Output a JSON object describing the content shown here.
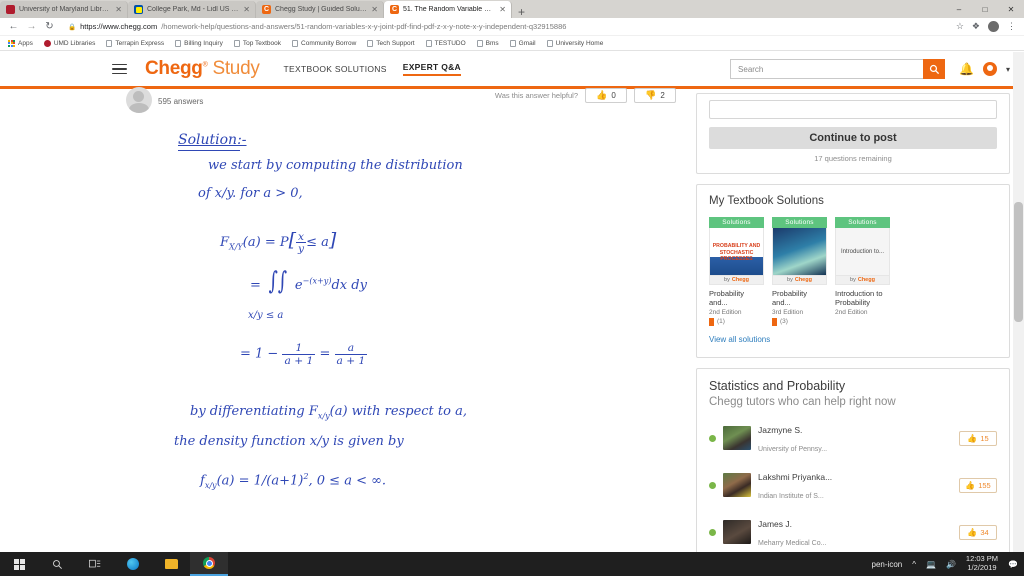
{
  "browser": {
    "tabs": [
      {
        "title": "University of Maryland Libraries",
        "favicon": "umd-icon",
        "active": false
      },
      {
        "title": "College Park, Md - Lidl US Jobs",
        "favicon": "lidl-icon",
        "active": false
      },
      {
        "title": "Chegg Study | Guided Solutions :",
        "favicon": "chegg-icon",
        "active": false
      },
      {
        "title": "51. The Random Variable X And",
        "favicon": "chegg-icon",
        "active": true
      }
    ],
    "new_tab_label": "+",
    "window_controls": {
      "minimize": "–",
      "maximize": "□",
      "close": "✕"
    },
    "nav": {
      "back": "←",
      "forward": "→",
      "reload": "↻",
      "lock": "🔒"
    },
    "url_host": "https://www.chegg.com",
    "url_path": "/homework-help/questions-and-answers/51-random-variables-x-y-joint-pdf-find-pdf-z-x-y-note-x-y-independent-q32915886",
    "toolbar_right": {
      "star": "☆",
      "extension": "❖",
      "profile": "",
      "menu": "⋮"
    },
    "bookmarks": [
      {
        "label": "Apps",
        "icon": "apps-grid-icon"
      },
      {
        "label": "UMD Libraries",
        "icon": "umd-icon"
      },
      {
        "label": "Terrapin Express",
        "icon": "page-icon"
      },
      {
        "label": "Billing Inquiry",
        "icon": "page-icon"
      },
      {
        "label": "Top Textbook",
        "icon": "page-icon"
      },
      {
        "label": "Community Borrow",
        "icon": "page-icon"
      },
      {
        "label": "Tech Support",
        "icon": "page-icon"
      },
      {
        "label": "TESTUDO",
        "icon": "page-icon"
      },
      {
        "label": "Bms",
        "icon": "page-icon"
      },
      {
        "label": "Gmail",
        "icon": "page-icon"
      },
      {
        "label": "University Home",
        "icon": "page-icon"
      }
    ]
  },
  "site_header": {
    "menu_icon": "hamburger-icon",
    "brand_main": "Chegg",
    "brand_tm": "®",
    "brand_sub": "Study",
    "nav": [
      {
        "label": "TEXTBOOK SOLUTIONS",
        "active": false
      },
      {
        "label": "EXPERT Q&A",
        "active": true
      }
    ],
    "search_placeholder": "Search",
    "search_value": "",
    "search_icon": "magnifier-icon",
    "bell_icon": "bell-icon",
    "avatar_icon": "user-avatar-icon",
    "caret_icon": "chevron-down-icon",
    "accent_color": "#ee6711"
  },
  "answer": {
    "author_answers": "595 answers",
    "helpful_label": "Was this answer helpful?",
    "thumbs_up_count": "0",
    "thumbs_down_count": "2",
    "thumb_up_icon": "thumbs-up-icon",
    "thumb_down_icon": "thumbs-down-icon",
    "handwriting": {
      "title": "Solution:-",
      "line1": "we start by computing the distribution",
      "line2": "of x/y.   for a > 0,",
      "eq1_lhs": "F",
      "eq1_sub": "X/Y",
      "eq1_arg": "(a)",
      "eq1_eq": "= P",
      "eq1_brk_open": "[",
      "eq1_frac_num": "x",
      "eq1_frac_den": "y",
      "eq1_rel": "≤ a",
      "eq1_brk_close": "]",
      "eq2_eq": "=",
      "eq2_int": "∫∫",
      "eq2_limit": "x/y ≤ a",
      "eq2_body": "e",
      "eq2_exp": "−(x+y)",
      "eq2_diff": "dx dy",
      "eq3_eq": "=  1 −",
      "eq3_f1_num": "1",
      "eq3_f1_den": "a + 1",
      "eq3_eq2": "=",
      "eq3_f2_num": "a",
      "eq3_f2_den": "a + 1",
      "line3": "by differentiating  F",
      "line3_sub": "x/y",
      "line3_cont": "(a)  with  respect  to  a,",
      "line4": "the  density  function   x/y  is  given  by",
      "eq4": "f",
      "eq4_sub": "x/y",
      "eq4_rest": "(a) = 1/(a+1)",
      "eq4_pow": "2",
      "eq4_range": ",  0 ≤ a < ∞."
    }
  },
  "sidebar": {
    "post_cta": "Continue to post",
    "post_note": "17 questions remaining",
    "textbooks": {
      "title": "My Textbook Solutions",
      "badge_label": "Solutions",
      "by_label": "by",
      "by_brand": "Chegg",
      "items": [
        {
          "cover_text": "PROBABILITY AND STOCHASTIC PROCESSES",
          "name": "Probability and...",
          "edition": "2nd Edition",
          "count": "(1)"
        },
        {
          "cover_text": "",
          "name": "Probability and...",
          "edition": "3rd Edition",
          "count": "(3)"
        },
        {
          "cover_text": "Introduction to...",
          "name": "Introduction to Probability",
          "edition": "2nd Edition",
          "count": ""
        }
      ],
      "view_all": "View all solutions"
    },
    "tutors": {
      "title": "Statistics and Probability",
      "subtitle": "Chegg tutors who can help right now",
      "items": [
        {
          "name": "Jazmyne S.",
          "school": "University of Pennsy...",
          "votes": "15"
        },
        {
          "name": "Lakshmi Priyanka...",
          "school": "Indian Institute of S...",
          "votes": "155"
        },
        {
          "name": "James J.",
          "school": "Meharry Medical Co...",
          "votes": "34"
        }
      ],
      "vote_icon": "thumbs-up-icon"
    }
  },
  "taskbar": {
    "start_icon": "windows-start-icon",
    "search_icon": "search-icon",
    "taskview_icon": "task-view-icon",
    "apps": [
      {
        "icon": "edge-icon",
        "active": false
      },
      {
        "icon": "file-explorer-icon",
        "active": false
      },
      {
        "icon": "chrome-icon",
        "active": true
      }
    ],
    "tray": {
      "pen_icon": "pen-icon",
      "chevron_icon": "chevron-up-icon",
      "network_icon": "network-icon",
      "volume_icon": "volume-icon",
      "action_center_icon": "action-center-icon"
    },
    "time": "12:03 PM",
    "date": "1/2/2019"
  }
}
